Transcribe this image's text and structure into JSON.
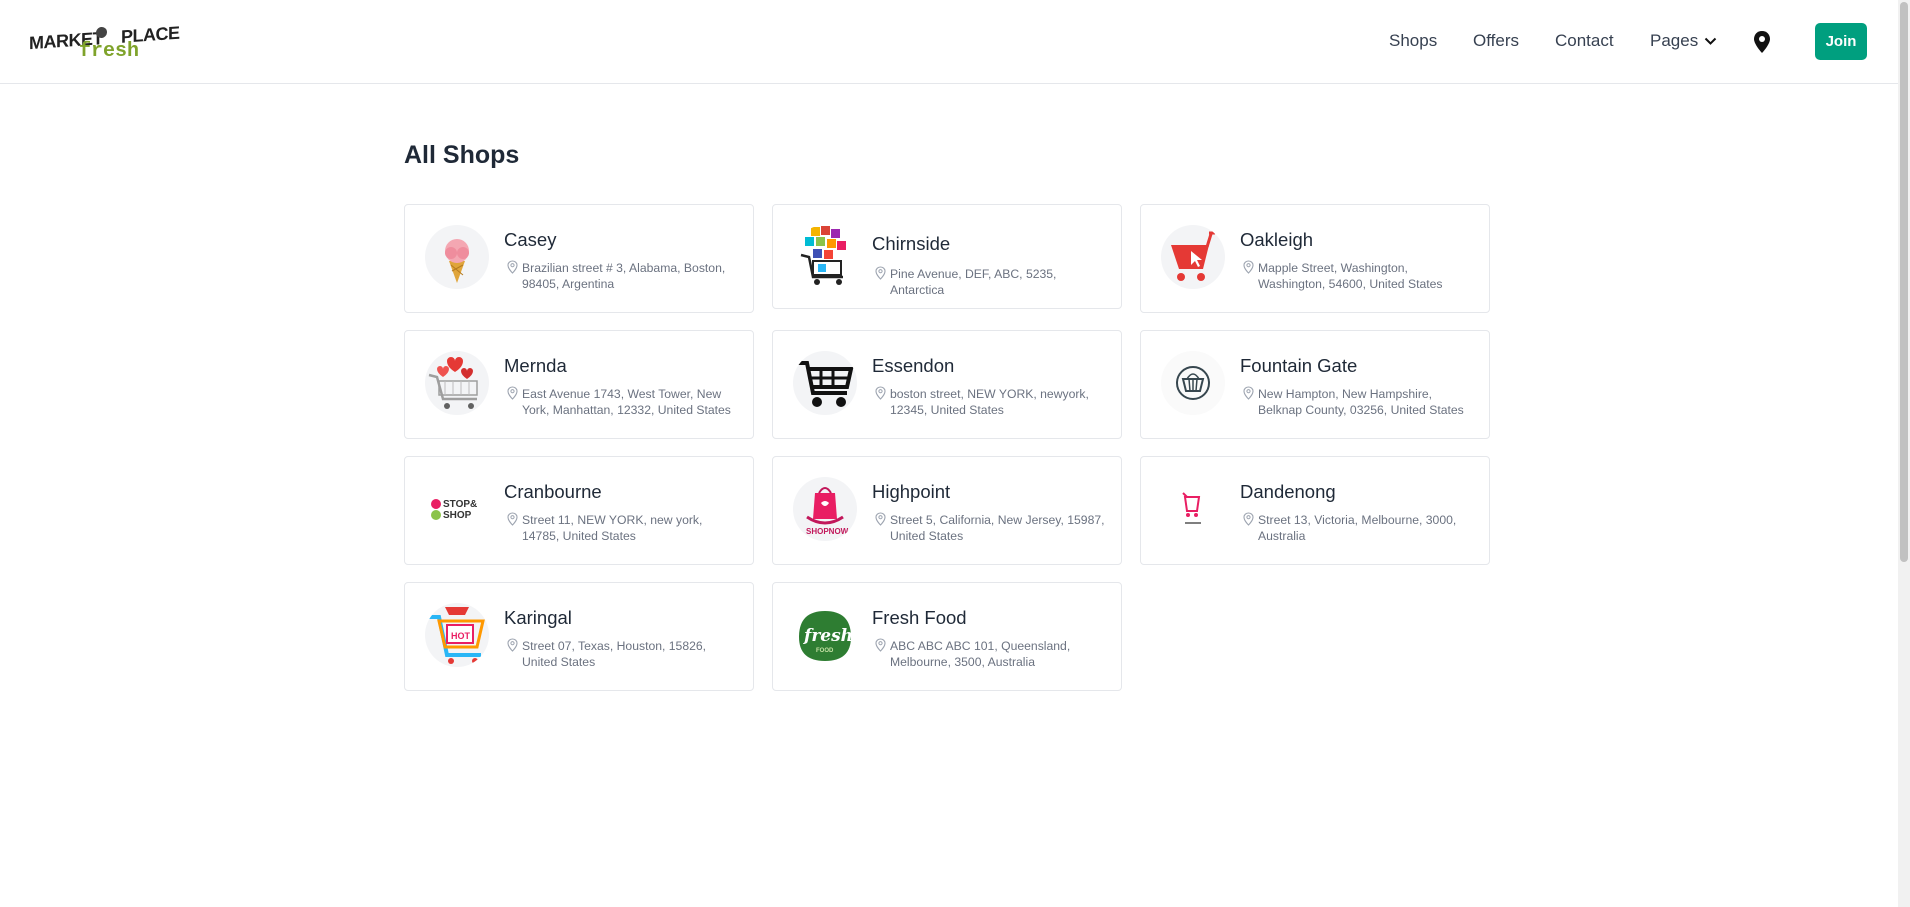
{
  "brand": {
    "logo_text": "MARKET PLACE fresh"
  },
  "nav": {
    "links": [
      "Shops",
      "Offers",
      "Contact"
    ],
    "pages_label": "Pages",
    "join_label": "Join"
  },
  "page": {
    "title": "All Shops"
  },
  "colors": {
    "accent": "#009f7f",
    "logo_green": "#7fa32b"
  },
  "shops": [
    {
      "name": "Casey",
      "address": "Brazilian street # 3, Alabama, Boston, 98405, Argentina",
      "avatar": "ice-cream-cone"
    },
    {
      "name": "Chirnside",
      "address": "Pine Avenue, DEF, ABC, 5235, Antarctica",
      "avatar": "shopping-cart-boxes"
    },
    {
      "name": "Oakleigh",
      "address": "Mapple Street, Washington, Washington, 54600, United States",
      "avatar": "red-cart"
    },
    {
      "name": "Mernda",
      "address": "East Avenue 1743, West Tower, New York, Manhattan, 12332, United States",
      "avatar": "cart-with-hearts"
    },
    {
      "name": "Essendon",
      "address": "boston street, NEW YORK, newyork, 12345, United States",
      "avatar": "black-cart"
    },
    {
      "name": "Fountain Gate",
      "address": "New Hampton, New Hampshire, Belknap County, 03256, United States",
      "avatar": "basket"
    },
    {
      "name": "Cranbourne",
      "address": "Street 11, NEW YORK, new york, 14785, United States",
      "avatar": "stop-and-shop-logo",
      "avatar_text": "STOP & SHOP"
    },
    {
      "name": "Highpoint",
      "address": "Street 5, California, New Jersey, 15987, United States",
      "avatar": "shopnow-bag",
      "avatar_text": "SHOPNOW"
    },
    {
      "name": "Dandenong",
      "address": "Street 13, Victoria, Melbourne, 3000, Australia",
      "avatar": "pink-cart"
    },
    {
      "name": "Karingal",
      "address": "Street 07, Texas, Houston, 15826, United States",
      "avatar": "hot-sale-cart",
      "avatar_text": "HOT"
    },
    {
      "name": "Fresh Food",
      "address": "ABC ABC ABC 101, Queensland, Melbourne, 3500, Australia",
      "avatar": "fresh-food-logo",
      "avatar_text": "fresh"
    }
  ]
}
